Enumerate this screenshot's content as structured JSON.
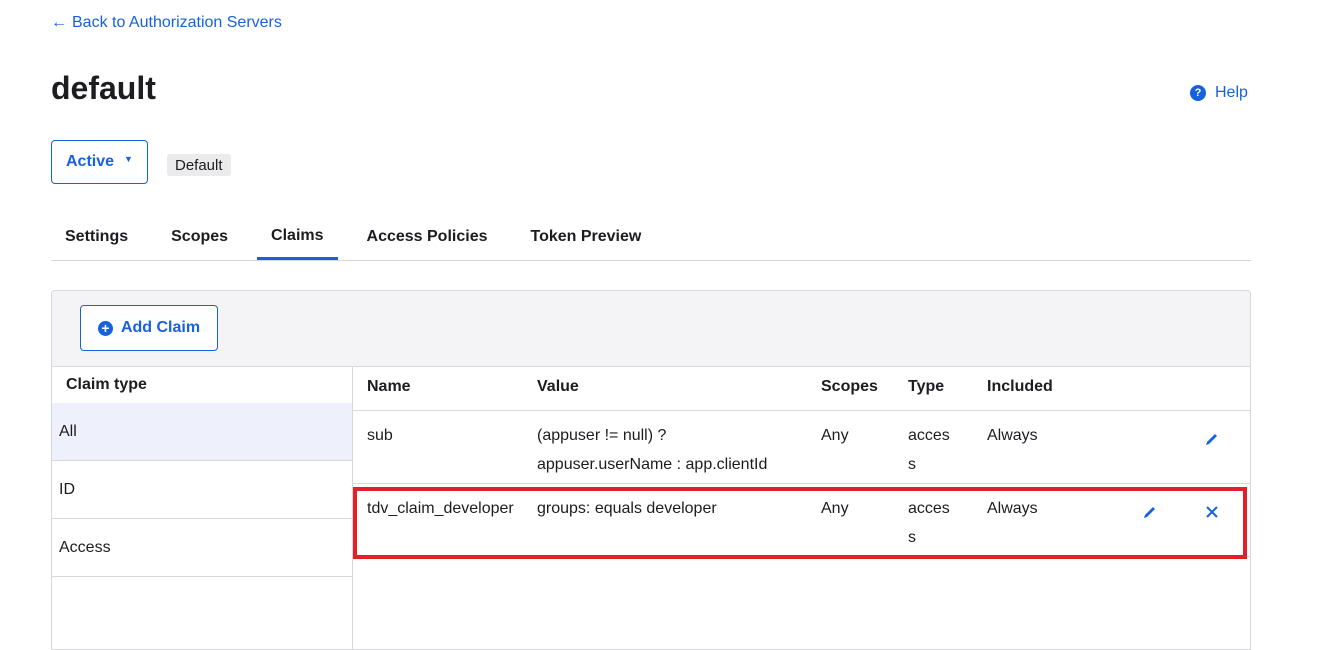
{
  "nav": {
    "back_label": "Back to Authorization Servers"
  },
  "header": {
    "title": "default",
    "help_label": "Help"
  },
  "status": {
    "label": "Active",
    "badge": "Default"
  },
  "tabs": [
    {
      "label": "Settings"
    },
    {
      "label": "Scopes"
    },
    {
      "label": "Claims"
    },
    {
      "label": "Access Policies"
    },
    {
      "label": "Token Preview"
    }
  ],
  "toolbar": {
    "add_claim_label": "Add Claim"
  },
  "sidebar": {
    "heading": "Claim type",
    "items": [
      {
        "label": "All"
      },
      {
        "label": "ID"
      },
      {
        "label": "Access"
      }
    ]
  },
  "table": {
    "headers": {
      "name": "Name",
      "value": "Value",
      "scopes": "Scopes",
      "type": "Type",
      "included": "Included"
    },
    "rows": [
      {
        "name": "sub",
        "value": "(appuser != null) ? appuser.userName : app.clientId",
        "scopes": "Any",
        "type": "access",
        "included": "Always"
      },
      {
        "name": "tdv_claim_developer",
        "value": "groups: equals developer",
        "scopes": "Any",
        "type": "access",
        "included": "Always"
      }
    ]
  },
  "colors": {
    "accent": "#1662dd",
    "highlight": "#e0202a"
  },
  "icons": {
    "help": "question-circle-icon",
    "add": "plus-circle-icon",
    "edit": "pencil-icon",
    "delete": "close-icon",
    "caret": "caret-down-icon",
    "back": "arrow-left-icon"
  }
}
